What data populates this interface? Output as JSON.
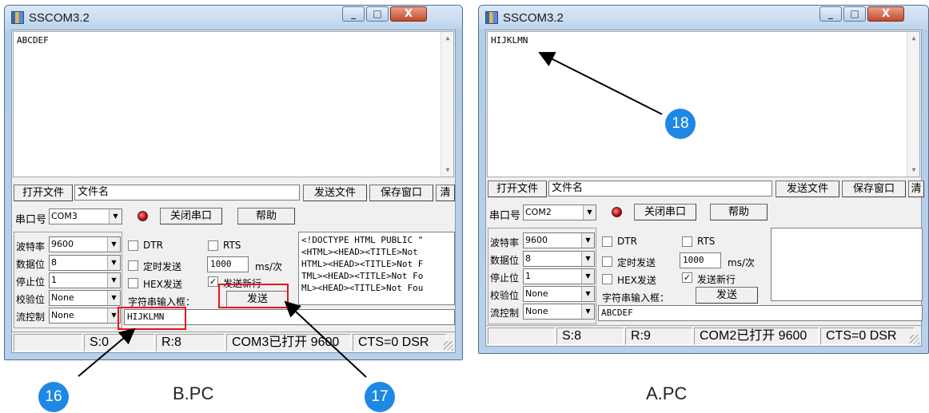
{
  "windowB": {
    "title": "SSCOM3.2",
    "controls": {
      "minimize": "_",
      "maximize": "□",
      "close": "X"
    },
    "receive_text": "ABCDEF",
    "open_file_button": "打开文件",
    "filename_field": "文件名",
    "send_file_button": "发送文件",
    "save_window_button": "保存窗口",
    "clear_button": "清",
    "port_label": "串口号",
    "port_value": "COM3",
    "close_port_button": "关闭串口",
    "help_button": "帮助",
    "baud_label": "波特率",
    "baud_value": "9600",
    "databits_label": "数据位",
    "databits_value": "8",
    "stopbits_label": "停止位",
    "stopbits_value": "1",
    "parity_label": "校验位",
    "parity_value": "None",
    "flow_label": "流控制",
    "flow_value": "None",
    "dtr_label": "DTR",
    "rts_label": "RTS",
    "timed_send_label": "定时发送",
    "interval_value": "1000",
    "interval_unit": "ms/次",
    "hex_send_label": "HEX发送",
    "newline_label": "发送新行",
    "input_label": "字符串输入框：",
    "send_button": "发送",
    "send_input_value": "HIJKLMN",
    "response_lines": [
      "<!DOCTYPE HTML PUBLIC \"",
      "<HTML><HEAD><TITLE>Not",
      "HTML><HEAD><TITLE>Not F",
      "TML><HEAD><TITLE>Not Fo",
      "ML><HEAD><TITLE>Not Fou"
    ],
    "status": {
      "blank": "",
      "sent": "S:0",
      "received": "R:8",
      "port_status": "COM3已打开  9600",
      "lines": "CTS=0 DSR"
    }
  },
  "windowA": {
    "title": "SSCOM3.2",
    "controls": {
      "minimize": "_",
      "maximize": "□",
      "close": "X"
    },
    "receive_text": "HIJKLMN",
    "open_file_button": "打开文件",
    "filename_field": "文件名",
    "send_file_button": "发送文件",
    "save_window_button": "保存窗口",
    "clear_button": "清",
    "port_label": "串口号",
    "port_value": "COM2",
    "close_port_button": "关闭串口",
    "help_button": "帮助",
    "baud_label": "波特率",
    "baud_value": "9600",
    "databits_label": "数据位",
    "databits_value": "8",
    "stopbits_label": "停止位",
    "stopbits_value": "1",
    "parity_label": "校验位",
    "parity_value": "None",
    "flow_label": "流控制",
    "flow_value": "None",
    "dtr_label": "DTR",
    "rts_label": "RTS",
    "timed_send_label": "定时发送",
    "interval_value": "1000",
    "interval_unit": "ms/次",
    "hex_send_label": "HEX发送",
    "newline_label": "发送新行",
    "input_label": "字符串输入框：",
    "send_button": "发送",
    "send_input_value": "ABCDEF",
    "status": {
      "blank": "",
      "sent": "S:8",
      "received": "R:9",
      "port_status": "COM2已打开  9600",
      "lines": "CTS=0 DSR"
    }
  },
  "annotations": {
    "callout_16": "16",
    "callout_17": "17",
    "callout_18": "18",
    "caption_left": "B.PC",
    "caption_right": "A.PC",
    "highlight_color": "#e8141b",
    "callout_color": "#1e88e5"
  }
}
